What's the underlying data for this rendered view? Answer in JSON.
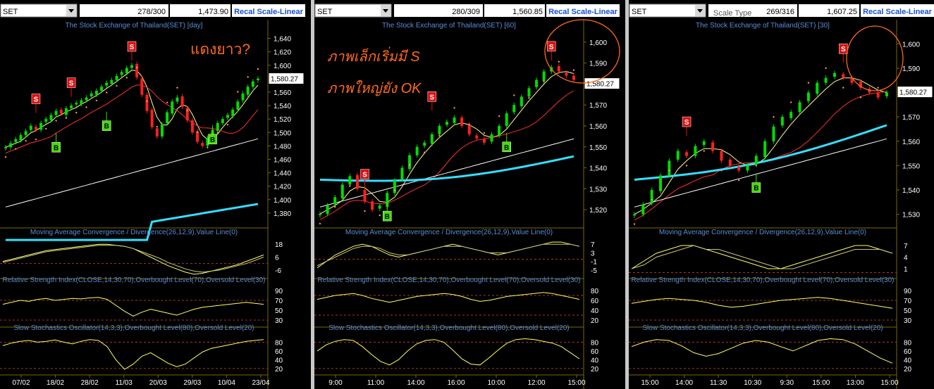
{
  "colors": {
    "background": "#000000",
    "grid": "#7a6a00",
    "label_text": "#5b8cd8",
    "axis_text": "#ffffff",
    "price_box": "#ffffff",
    "toolbar": "#ffffff",
    "recal_text": "#1a4fd0",
    "annotation": "#ff6a1a",
    "sell_marker": "#e01010",
    "buy_marker": "#44dd00",
    "ma_short": "#ffff90",
    "ma_mid": "#ff3030",
    "ma_long": "#ffffff",
    "ma_200": "#33e0ff",
    "sar": "#ff9070",
    "candle_up": "#00dd00",
    "candle_down": "#ff2020",
    "macd_line": "#ffff60",
    "signal_line": "#c8c880",
    "level_line": "#b03030"
  },
  "panels": [
    {
      "symbol": "SET",
      "records": "278/300",
      "last_value": "1,473.90",
      "recal_label": "Recal Scale-Linear",
      "scale_type_label": "",
      "chart_title": "The Stock Exchange of Thailand(SET) [day]",
      "price_label": "1,580.27",
      "price_ticks": [
        "1,640",
        "1,620",
        "1,600",
        "1,580",
        "1,560",
        "1,540",
        "1,520",
        "1,500",
        "1,480",
        "1,460",
        "1,440",
        "1,420",
        "1,400",
        "1,380"
      ],
      "annotations": [
        {
          "text": "แดงยาว?"
        }
      ],
      "sell_label": "S",
      "buy_label": "B",
      "macd_title": "Moving Average Convergence / Divergence(26,12,9),Value Line(0)",
      "macd_ticks": [
        "18",
        "6",
        "-6"
      ],
      "rsi_title": "Relative Strength Index(CLOSE,14,30,70),Overbought Level(70),Oversold Level(30)",
      "rsi_ticks": [
        "90",
        "70",
        "50",
        "30"
      ],
      "stoch_title": "Slow Stochastics Oscillator(14,3,3),Overbought Level(80),Oversold Level(20)",
      "stoch_ticks": [
        "80",
        "60",
        "40",
        "20"
      ],
      "x_ticks": [
        "07/02",
        "18/02",
        "28/02",
        "11/03",
        "20/03",
        "29/03",
        "10/04",
        "23/04"
      ]
    },
    {
      "symbol": "SET",
      "records": "280/309",
      "last_value": "1,560.85",
      "recal_label": "Recal Scale-Linear",
      "scale_type_label": "",
      "chart_title": "The Stock Exchange of Thailand(SET) [60]",
      "price_label": "1,580.27",
      "price_ticks": [
        "1,600",
        "1,590",
        "1,580",
        "1,570",
        "1,560",
        "1,550",
        "1,540",
        "1,530",
        "1,520"
      ],
      "annotations": [
        {
          "text": "ภาพเล็กเริ่มมี S"
        },
        {
          "text": "ภาพใหญ่ยัง OK"
        }
      ],
      "sell_label": "S",
      "buy_label": "B",
      "macd_title": "Moving Average Convergence / Divergence(26,12,9),Value Line(0)",
      "macd_ticks": [
        "7",
        "3",
        "-1",
        "-5"
      ],
      "rsi_title": "Relative Strength Index(CLOSE,14,30,70),Overbought Level(70),Oversold Level(30)",
      "rsi_ticks": [
        "80",
        "60",
        "40",
        "20"
      ],
      "stoch_title": "Slow Stochastics Oscillator(14,3,3),Overbought Level(80),Oversold Level(20)",
      "stoch_ticks": [
        "80",
        "60",
        "40",
        "20"
      ],
      "x_ticks": [
        "9:00",
        "11:00",
        "14:00",
        "16:00",
        "10:00",
        "12:00",
        "15:00"
      ]
    },
    {
      "symbol": "SET",
      "records": "269/316",
      "last_value": "1,607.25",
      "recal_label": "Recal Scale-Linear",
      "scale_type_label": "Scale Type",
      "chart_title": "The Stock Exchange of Thailand(SET) [30]",
      "price_label": "1,580.27",
      "price_ticks": [
        "1,600",
        "1,590",
        "1,580",
        "1,570",
        "1,560",
        "1,550",
        "1,540",
        "1,530"
      ],
      "annotations": [],
      "sell_label": "S",
      "buy_label": "B",
      "macd_title": "Moving Average Convergence / Divergence(26,12,9),Value Line(0)",
      "macd_ticks": [
        "7",
        "4",
        "1"
      ],
      "rsi_title": "Relative Strength Index(CLOSE,14,30,70),Overbought Level(70),Oversold Level(30)",
      "rsi_ticks": [
        "90",
        "70",
        "50",
        "30"
      ],
      "stoch_title": "Slow Stochastics Oscillator(14,3,3),Overbought Level(80),Oversold Level(20)",
      "stoch_ticks": [
        "80",
        "60",
        "40",
        "20"
      ],
      "x_ticks": [
        "15:00",
        "14:00",
        "11:30",
        "10:30",
        "9:30",
        "15:00",
        "13:00",
        "15:00"
      ]
    }
  ],
  "chart_data": [
    {
      "type": "candlestick",
      "title": "The Stock Exchange of Thailand(SET) [day]",
      "x_ticks": [
        "07/02",
        "18/02",
        "28/02",
        "11/03",
        "20/03",
        "29/03",
        "10/04",
        "23/04"
      ],
      "ylim": [
        1360,
        1650
      ],
      "close_series": [
        1478,
        1484,
        1490,
        1496,
        1502,
        1510,
        1504,
        1514,
        1520,
        1526,
        1532,
        1528,
        1536,
        1540,
        1544,
        1548,
        1552,
        1558,
        1562,
        1568,
        1574,
        1578,
        1584,
        1590,
        1596,
        1600,
        1582,
        1556,
        1532,
        1508,
        1494,
        1512,
        1530,
        1546,
        1552,
        1538,
        1518,
        1500,
        1486,
        1480,
        1492,
        1504,
        1514,
        1520,
        1526,
        1534,
        1546,
        1558,
        1568,
        1576,
        1580
      ],
      "sell_signals": [
        {
          "index": 6,
          "value": 1550
        },
        {
          "index": 13,
          "value": 1574
        },
        {
          "index": 25,
          "value": 1628
        }
      ],
      "buy_signals": [
        {
          "index": 10,
          "value": 1478
        },
        {
          "index": 20,
          "value": 1510
        },
        {
          "index": 41,
          "value": 1490
        }
      ],
      "indicators": {
        "macd": {
          "ylim": [
            -12,
            24
          ],
          "levels": [
            0
          ],
          "line": [
            2,
            4,
            6,
            8,
            10,
            12,
            13,
            14,
            15,
            16,
            17,
            18,
            18,
            17,
            16,
            14,
            10,
            6,
            2,
            -2,
            -5,
            -8,
            -10,
            -9,
            -7,
            -5,
            -3,
            -1,
            2,
            5,
            8
          ],
          "signal": [
            1,
            3,
            5,
            7,
            9,
            11,
            12,
            13,
            14,
            15,
            16,
            17,
            17,
            17,
            16,
            14,
            11,
            8,
            5,
            1,
            -2,
            -5,
            -7,
            -8,
            -7,
            -6,
            -4,
            -2,
            0,
            3,
            6
          ]
        },
        "rsi": {
          "ylim": [
            20,
            100
          ],
          "levels": [
            70,
            30
          ],
          "line": [
            62,
            66,
            70,
            68,
            72,
            74,
            70,
            72,
            74,
            73,
            75,
            76,
            72,
            60,
            48,
            38,
            46,
            52,
            48,
            44,
            40,
            46,
            52,
            56,
            58,
            60,
            62,
            64,
            66,
            64,
            62
          ]
        },
        "stochastic": {
          "ylim": [
            10,
            100
          ],
          "levels": [
            80,
            20
          ],
          "line": [
            72,
            78,
            82,
            84,
            80,
            82,
            85,
            80,
            76,
            82,
            86,
            84,
            70,
            40,
            18,
            30,
            48,
            56,
            44,
            32,
            24,
            30,
            44,
            58,
            66,
            70,
            74,
            78,
            82,
            84,
            86
          ]
        }
      }
    },
    {
      "type": "candlestick",
      "title": "The Stock Exchange of Thailand(SET) [60]",
      "x_ticks": [
        "9:00",
        "11:00",
        "14:00",
        "16:00",
        "10:00",
        "12:00",
        "15:00"
      ],
      "ylim": [
        1512,
        1605
      ],
      "close_series": [
        1518,
        1522,
        1526,
        1532,
        1536,
        1530,
        1524,
        1520,
        1522,
        1528,
        1534,
        1540,
        1546,
        1550,
        1552,
        1556,
        1560,
        1562,
        1564,
        1560,
        1556,
        1554,
        1552,
        1556,
        1560,
        1566,
        1570,
        1574,
        1578,
        1582,
        1586,
        1588,
        1586,
        1584,
        1582
      ],
      "sell_signals": [
        {
          "index": 6,
          "value": 1537
        },
        {
          "index": 15,
          "value": 1574
        },
        {
          "index": 31,
          "value": 1598
        }
      ],
      "buy_signals": [
        {
          "index": 9,
          "value": 1517
        },
        {
          "index": 25,
          "value": 1550
        }
      ],
      "indicators": {
        "macd": {
          "ylim": [
            -8,
            10
          ],
          "levels": [
            0
          ],
          "line": [
            -4,
            -1,
            2,
            4,
            6,
            7,
            6,
            4,
            2,
            1,
            2,
            3,
            4,
            5,
            6,
            7,
            6,
            5,
            4,
            3,
            2,
            3,
            4,
            5,
            6,
            7,
            8,
            8,
            7,
            6
          ],
          "signal": [
            -3,
            -1,
            1,
            3,
            5,
            6,
            6,
            5,
            3,
            2,
            2,
            3,
            4,
            5,
            6,
            6,
            6,
            5,
            4,
            3,
            3,
            3,
            4,
            5,
            6,
            7,
            7,
            7,
            7,
            6
          ]
        },
        "rsi": {
          "ylim": [
            10,
            90
          ],
          "levels": [
            70,
            30
          ],
          "line": [
            62,
            66,
            70,
            72,
            74,
            70,
            64,
            60,
            56,
            60,
            64,
            68,
            70,
            72,
            74,
            72,
            68,
            62,
            58,
            60,
            64,
            68,
            70,
            72,
            74,
            76,
            74,
            70,
            66,
            62
          ]
        },
        "stochastic": {
          "ylim": [
            10,
            100
          ],
          "levels": [
            80,
            20
          ],
          "line": [
            60,
            74,
            82,
            86,
            84,
            70,
            52,
            36,
            28,
            40,
            60,
            76,
            84,
            86,
            80,
            62,
            42,
            30,
            28,
            44,
            62,
            78,
            86,
            88,
            86,
            82,
            78,
            70,
            56,
            42
          ]
        }
      }
    },
    {
      "type": "candlestick",
      "title": "The Stock Exchange of Thailand(SET) [30]",
      "x_ticks": [
        "15:00",
        "14:00",
        "11:30",
        "10:30",
        "9:30",
        "15:00",
        "13:00",
        "15:00"
      ],
      "ylim": [
        1525,
        1605
      ],
      "close_series": [
        1530,
        1534,
        1540,
        1546,
        1552,
        1556,
        1554,
        1558,
        1560,
        1556,
        1552,
        1550,
        1548,
        1550,
        1554,
        1560,
        1566,
        1570,
        1572,
        1576,
        1580,
        1584,
        1586,
        1588,
        1586,
        1584,
        1582,
        1580,
        1578,
        1580
      ],
      "sell_signals": [
        {
          "index": 6,
          "value": 1568
        },
        {
          "index": 24,
          "value": 1598
        }
      ],
      "buy_signals": [
        {
          "index": 14,
          "value": 1541
        }
      ],
      "indicators": {
        "macd": {
          "ylim": [
            -1,
            9
          ],
          "levels": [
            0
          ],
          "line": [
            1,
            3,
            5,
            6,
            7,
            7,
            6,
            5,
            4,
            3,
            2,
            1,
            1,
            2,
            3,
            4,
            5,
            6,
            7,
            7,
            6,
            5
          ],
          "signal": [
            1,
            2,
            4,
            5,
            6,
            7,
            6,
            6,
            5,
            4,
            3,
            2,
            1,
            1,
            2,
            3,
            4,
            5,
            6,
            6,
            6,
            5
          ]
        },
        "rsi": {
          "ylim": [
            20,
            100
          ],
          "levels": [
            70,
            30
          ],
          "line": [
            64,
            68,
            72,
            74,
            72,
            70,
            66,
            60,
            56,
            58,
            62,
            66,
            70,
            72,
            74,
            76,
            74,
            70,
            66,
            62,
            58,
            54
          ]
        },
        "stochastic": {
          "ylim": [
            10,
            100
          ],
          "levels": [
            80,
            20
          ],
          "line": [
            70,
            80,
            86,
            84,
            72,
            56,
            48,
            54,
            66,
            78,
            84,
            80,
            70,
            60,
            72,
            84,
            88,
            86,
            76,
            60,
            44,
            32
          ]
        }
      }
    }
  ]
}
